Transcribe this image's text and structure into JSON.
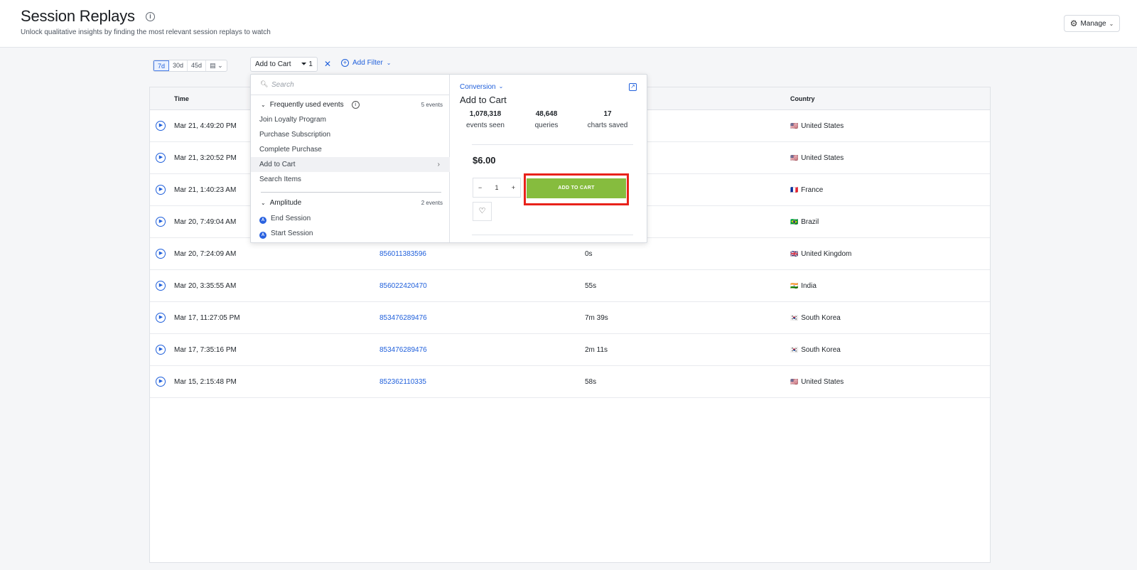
{
  "header": {
    "title": "Session Replays",
    "subtitle": "Unlock qualitative insights by finding the most relevant session replays to watch",
    "manage_label": "Manage"
  },
  "toolbar": {
    "ranges": [
      "7d",
      "30d",
      "45d"
    ],
    "active_range": "7d",
    "filter_event": "Add to Cart",
    "filter_count": "1",
    "add_filter_label": "Add Filter"
  },
  "table": {
    "headers": {
      "time": "Time",
      "country": "Country"
    },
    "rows": [
      {
        "time": "Mar 21, 4:49:20 PM",
        "user_id": "",
        "duration": "",
        "flag": "🇺🇸",
        "country": "United States"
      },
      {
        "time": "Mar 21, 3:20:52 PM",
        "user_id": "",
        "duration": "",
        "flag": "🇺🇸",
        "country": "United States"
      },
      {
        "time": "Mar 21, 1:40:23 AM",
        "user_id": "",
        "duration": "",
        "flag": "🇫🇷",
        "country": "France"
      },
      {
        "time": "Mar 20, 7:49:04 AM",
        "user_id": "",
        "duration": "",
        "flag": "🇧🇷",
        "country": "Brazil"
      },
      {
        "time": "Mar 20, 7:24:09 AM",
        "user_id": "856011383596",
        "duration": "0s",
        "flag": "🇬🇧",
        "country": "United Kingdom"
      },
      {
        "time": "Mar 20, 3:35:55 AM",
        "user_id": "856022420470",
        "duration": "55s",
        "flag": "🇮🇳",
        "country": "India"
      },
      {
        "time": "Mar 17, 11:27:05 PM",
        "user_id": "853476289476",
        "duration": "7m 39s",
        "flag": "🇰🇷",
        "country": "South Korea"
      },
      {
        "time": "Mar 17, 7:35:16 PM",
        "user_id": "853476289476",
        "duration": "2m 11s",
        "flag": "🇰🇷",
        "country": "South Korea"
      },
      {
        "time": "Mar 15, 2:15:48 PM",
        "user_id": "852362110335",
        "duration": "58s",
        "flag": "🇺🇸",
        "country": "United States"
      }
    ]
  },
  "dropdown": {
    "search_placeholder": "Search",
    "groups": [
      {
        "label": "Frequently used events",
        "count": "5 events",
        "items": [
          "Join Loyalty Program",
          "Purchase Subscription",
          "Complete Purchase",
          "Add to Cart",
          "Search Items"
        ]
      },
      {
        "label": "Amplitude",
        "count": "2 events",
        "items": [
          "End Session",
          "Start Session"
        ]
      }
    ],
    "highlighted_item": "Add to Cart"
  },
  "detail": {
    "category": "Conversion",
    "event_name": "Add to Cart",
    "stats": [
      {
        "value": "1,078,318",
        "label": "events seen"
      },
      {
        "value": "48,648",
        "label": "queries"
      },
      {
        "value": "17",
        "label": "charts saved"
      }
    ],
    "price": "$6.00",
    "quantity": "1",
    "button_label": "ADD TO CART"
  },
  "colors": {
    "accent": "#1f5fdb",
    "add_to_cart_green": "#86bc3e",
    "highlight_red": "#e8221b"
  }
}
